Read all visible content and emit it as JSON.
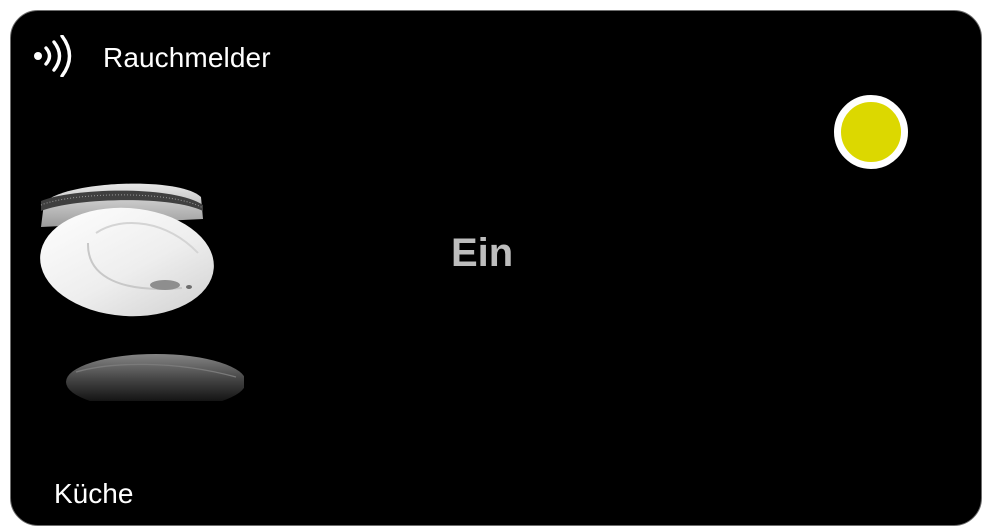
{
  "widget": {
    "title": "Rauchmelder",
    "state": "Ein",
    "room": "Küche",
    "title_icon": "wireless-signal-icon",
    "device_image": "smoke-detector-icon",
    "status_color": "#dcd800",
    "state_color": "#bdbdbd",
    "background_color": "#000000"
  }
}
